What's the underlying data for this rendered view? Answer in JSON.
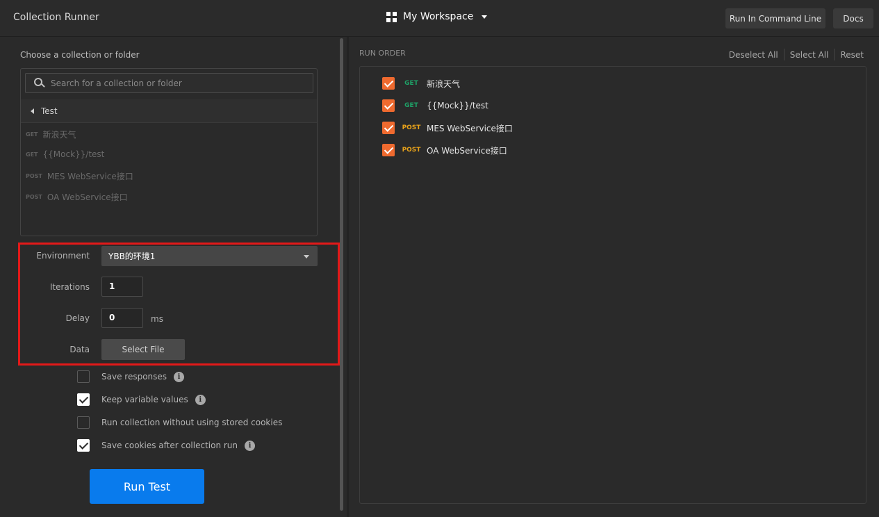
{
  "header": {
    "title": "Collection Runner",
    "workspace": "My Workspace",
    "run_cli_label": "Run In Command Line",
    "docs_label": "Docs"
  },
  "left": {
    "choose_label": "Choose a collection or folder",
    "search_placeholder": "Search for a collection or folder",
    "collection_name": "Test",
    "requests": [
      {
        "method": "GET",
        "name": "新浪天气"
      },
      {
        "method": "GET",
        "name": "{{Mock}}/test"
      },
      {
        "method": "POST",
        "name": "MES WebService接口"
      },
      {
        "method": "POST",
        "name": "OA WebService接口"
      }
    ],
    "environment_label": "Environment",
    "environment_value": "YBB的环境1",
    "iterations_label": "Iterations",
    "iterations_value": "1",
    "delay_label": "Delay",
    "delay_value": "0",
    "delay_unit": "ms",
    "data_label": "Data",
    "select_file_label": "Select File",
    "options": [
      {
        "label": "Save responses",
        "checked": false,
        "info": true
      },
      {
        "label": "Keep variable values",
        "checked": true,
        "info": true
      },
      {
        "label": "Run collection without using stored cookies",
        "checked": false,
        "info": false
      },
      {
        "label": "Save cookies after collection run",
        "checked": true,
        "info": true
      }
    ],
    "run_button": "Run Test"
  },
  "right": {
    "heading": "RUN ORDER",
    "deselect_all": "Deselect All",
    "select_all": "Select All",
    "reset": "Reset",
    "order": [
      {
        "method": "GET",
        "name": "新浪天气",
        "checked": true
      },
      {
        "method": "GET",
        "name": "{{Mock}}/test",
        "checked": true
      },
      {
        "method": "POST",
        "name": "MES WebService接口",
        "checked": true
      },
      {
        "method": "POST",
        "name": "OA WebService接口",
        "checked": true
      }
    ]
  },
  "colors": {
    "accent_blue": "#097bed",
    "checkbox_orange": "#ef6a2f",
    "get_green": "#1ea368",
    "post_orange": "#e9a31a",
    "highlight_red": "#e31919"
  }
}
